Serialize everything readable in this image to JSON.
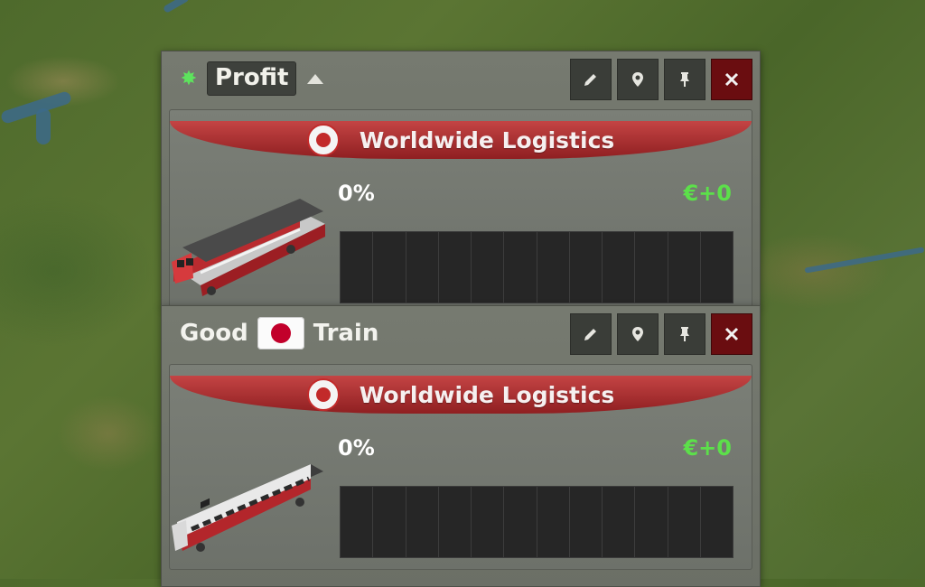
{
  "window1": {
    "sort_label": "Profit",
    "buttons": [
      "rename",
      "locate",
      "pin",
      "close"
    ],
    "card": {
      "company": "Worldwide Logistics",
      "percent": "0%",
      "profit": "€+0",
      "graph_bars": 12
    }
  },
  "window2": {
    "title_prefix": "Good",
    "title_suffix": "Train",
    "flag": "japan-flag",
    "buttons": [
      "rename",
      "locate",
      "pin",
      "close"
    ],
    "card": {
      "company": "Worldwide Logistics",
      "percent": "0%",
      "profit": "€+0",
      "graph_bars": 12
    }
  },
  "colors": {
    "profit_green": "#5ce04a",
    "close_red": "#6a0d10",
    "banner_red": "#b33a3b"
  }
}
